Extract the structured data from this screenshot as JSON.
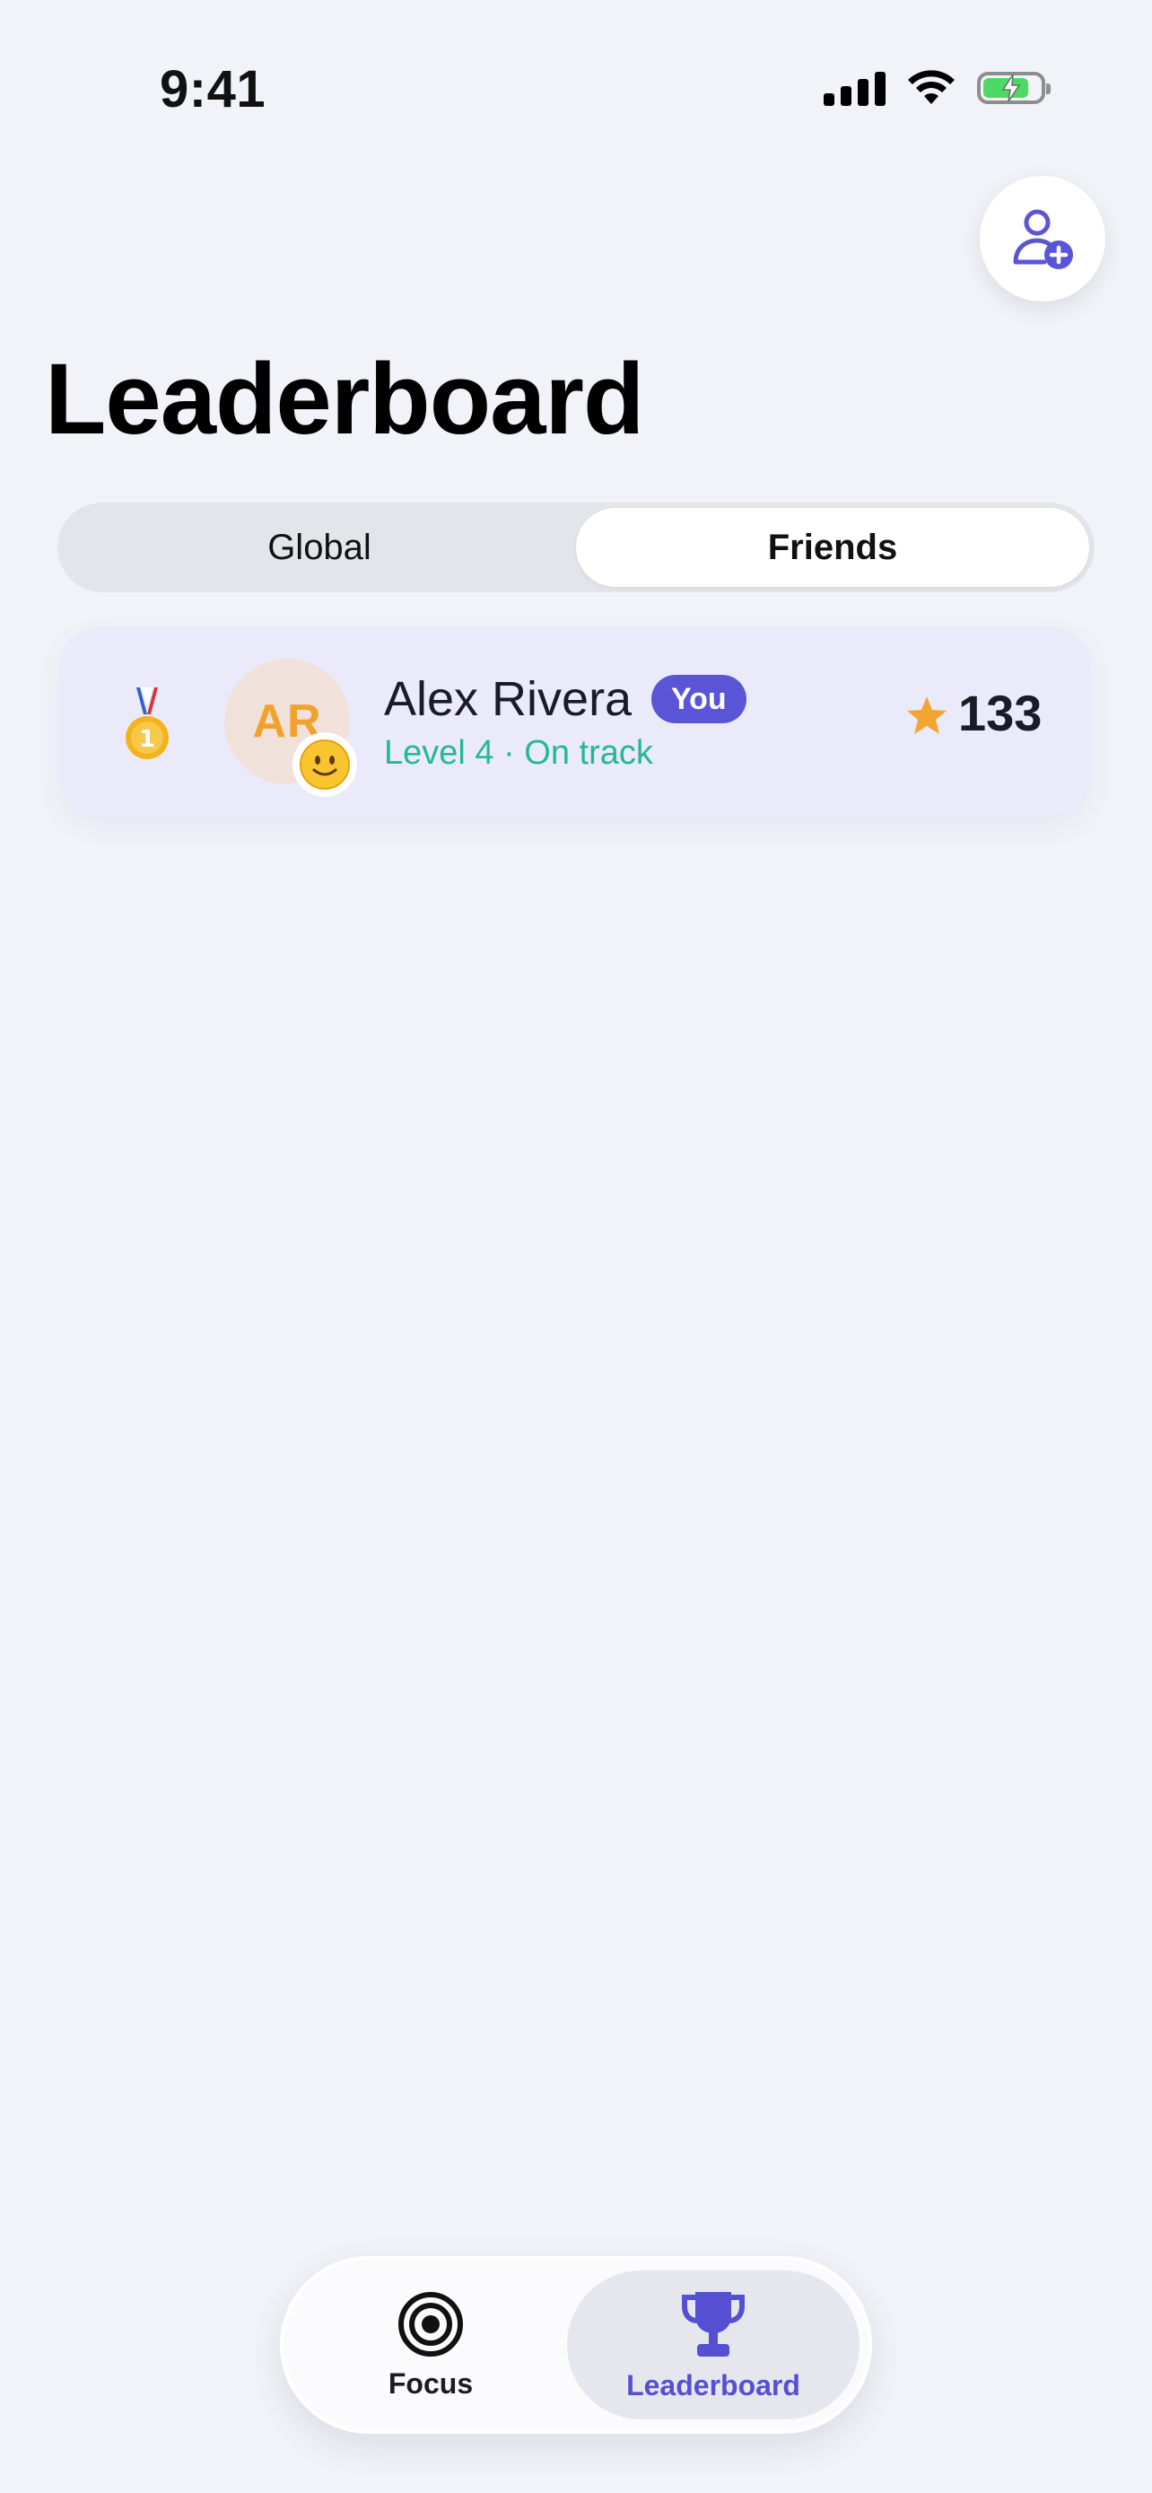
{
  "status_bar": {
    "time": "9:41"
  },
  "page": {
    "title": "Leaderboard"
  },
  "segments": {
    "global": "Global",
    "friends": "Friends",
    "selected": "Friends"
  },
  "rows": [
    {
      "rank_icon": "gold-medal-icon",
      "initials": "AR",
      "mood_icon": "smile-emoji-icon",
      "name": "Alex Rivera",
      "badge": "You",
      "subtitle": "Level 4 · On track",
      "score": "133"
    }
  ],
  "tabs": [
    {
      "label": "Focus",
      "icon": "target-icon"
    },
    {
      "label": "Leaderboard",
      "icon": "trophy-icon",
      "selected": true
    }
  ],
  "colors": {
    "accent": "#5a55d6",
    "status_green": "#25b993",
    "star": "#f3a533"
  }
}
